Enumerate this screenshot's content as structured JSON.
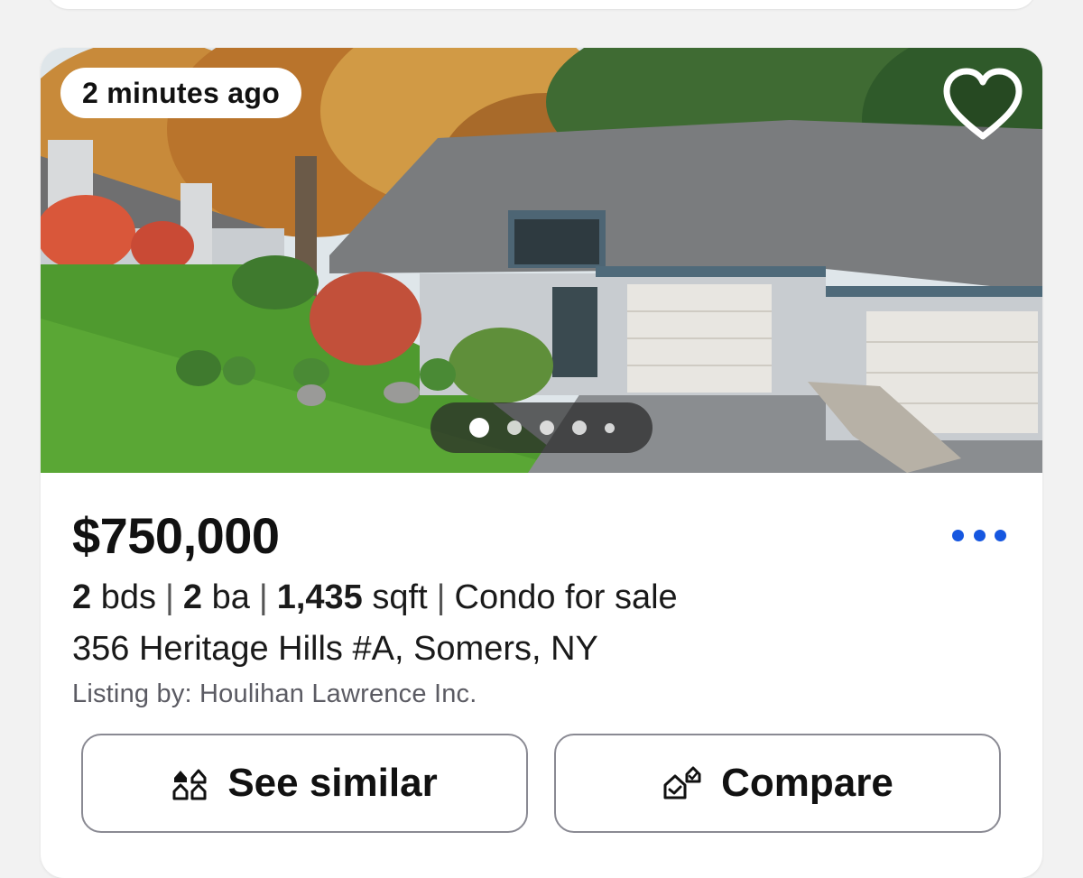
{
  "listing": {
    "time_badge": "2 minutes ago",
    "favorite_icon": "heart-outline-icon",
    "photo_count_dots": 5,
    "active_photo_index": 0,
    "price": "$750,000",
    "beds_value": "2",
    "beds_unit": "bds",
    "baths_value": "2",
    "baths_unit": "ba",
    "sqft_value": "1,435",
    "sqft_unit": "sqft",
    "type": "Condo for sale",
    "separator": "|",
    "address": "356 Heritage Hills #A, Somers, NY",
    "broker": "Listing by: Houlihan Lawrence Inc."
  },
  "actions": {
    "see_similar_label": "See similar",
    "compare_label": "Compare"
  },
  "colors": {
    "accent_blue": "#1657e0",
    "text_primary": "#111111",
    "text_secondary": "#5b5b63",
    "button_border": "#8a8a93"
  }
}
